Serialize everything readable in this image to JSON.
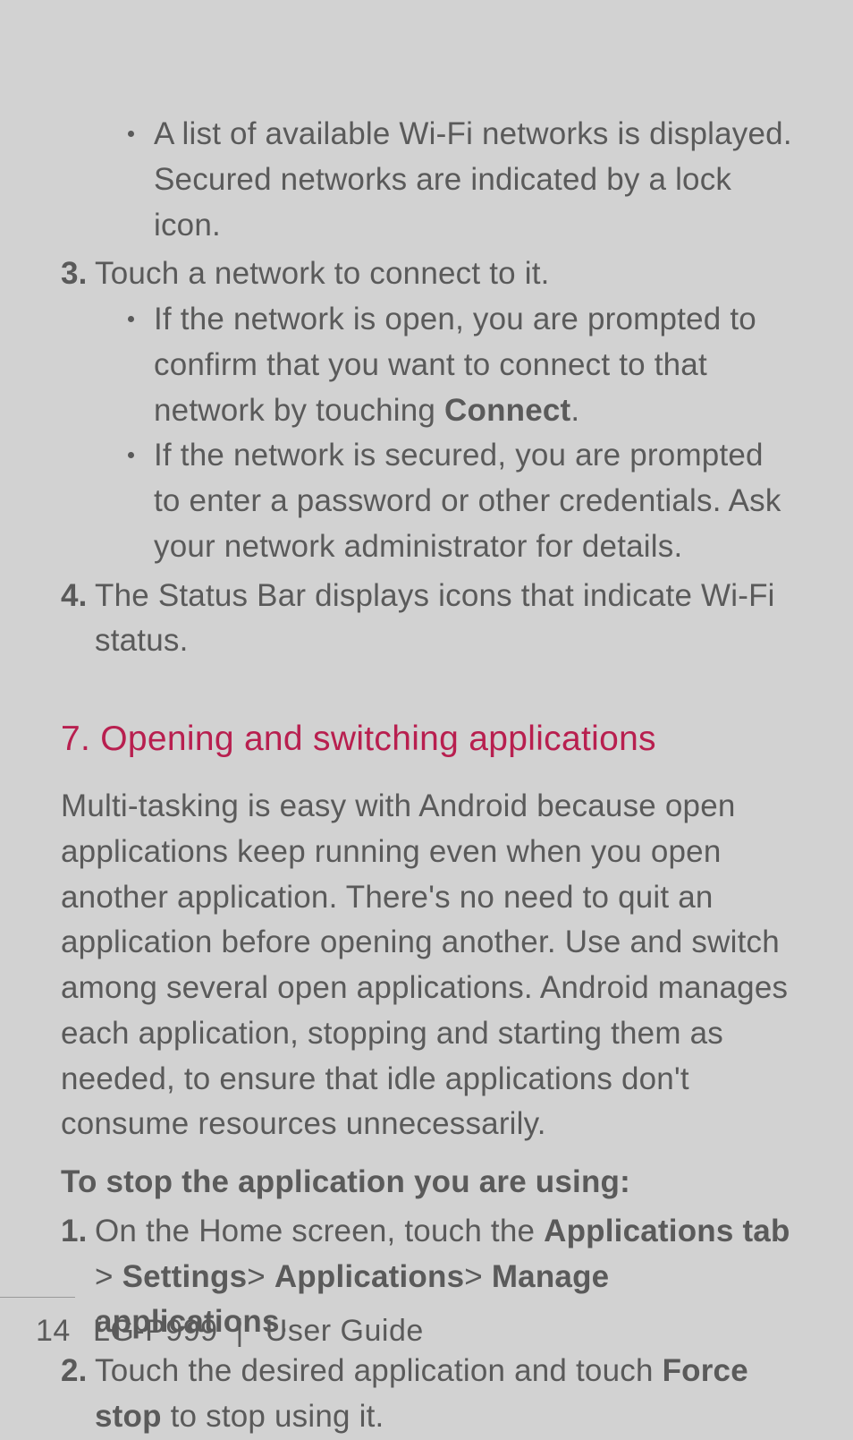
{
  "bullets_top": {
    "b1": "A list of available Wi-Fi networks is displayed. Secured networks are indicated by a lock icon."
  },
  "step3": {
    "marker": "3.",
    "text": "Touch a network to connect to it.",
    "sub_b1_a": "If the network is open, you are prompted to confirm that you want to connect to that network by touching ",
    "sub_b1_bold": "Connect",
    "sub_b1_b": ".",
    "sub_b2": "If the network is secured, you are prompted to enter a password or other credentials. Ask your network administrator for details."
  },
  "step4": {
    "marker": "4.",
    "text": "The Status Bar displays icons that indicate Wi-Fi status."
  },
  "heading": "7. Opening and switching applications",
  "para1": "Multi-tasking is easy with Android because open applications keep running even when you open another application. There's no need to quit an application before opening another. Use and switch among several open applications. Android manages each application, stopping and starting them as needed, to ensure that idle applications don't consume resources unnecessarily.",
  "subheading": "To stop the application you are using:",
  "stop1": {
    "marker": "1.",
    "a": "On the Home screen, touch the ",
    "apps_tab": "Applications tab",
    "gt1": " > ",
    "settings": "Settings",
    "gt2": "> ",
    "applications": "Applications",
    "gt3": "> ",
    "manage": "Manage applications",
    "end": "."
  },
  "stop2": {
    "marker": "2.",
    "a": "Touch the desired application and touch ",
    "force_stop": "Force stop",
    "b": " to stop using it."
  },
  "footer": {
    "page": "14",
    "model": "LG-P999",
    "sep": "|",
    "title": "User Guide"
  }
}
